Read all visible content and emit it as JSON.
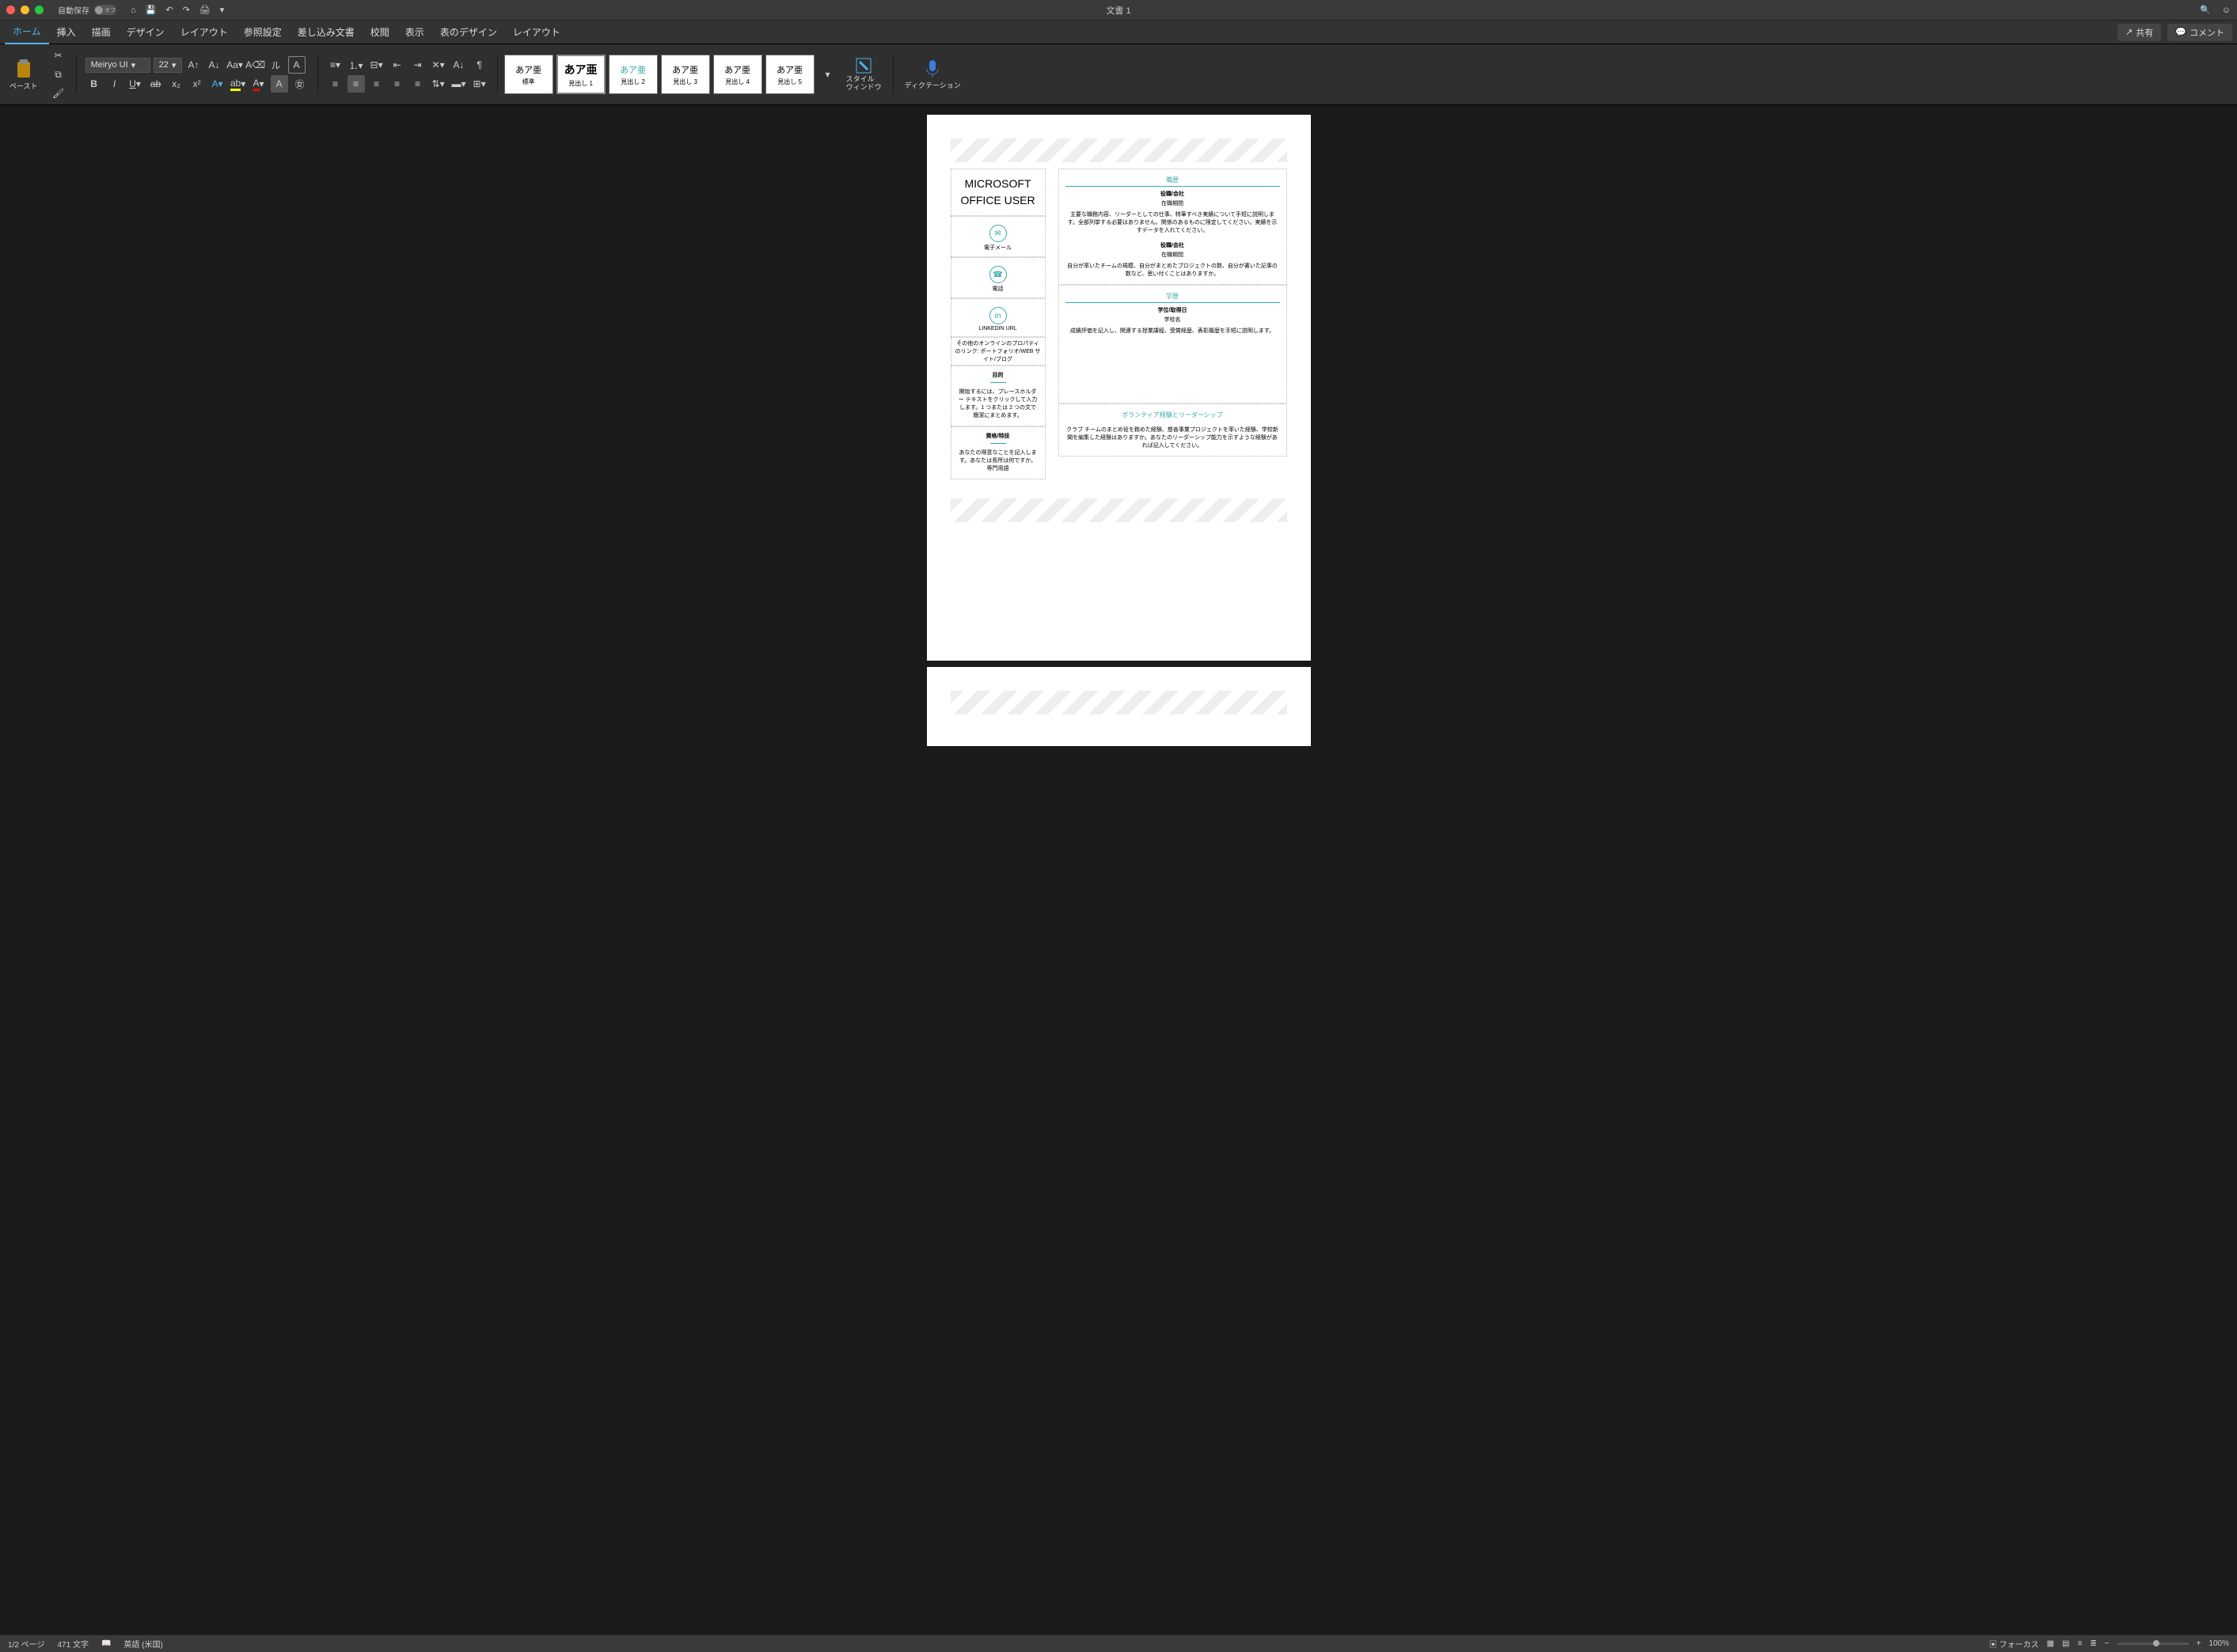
{
  "titlebar": {
    "autosave_label": "自動保存",
    "autosave_state": "オフ",
    "doc_title": "文書 1"
  },
  "menubar": {
    "tabs": [
      "ホーム",
      "挿入",
      "描画",
      "デザイン",
      "レイアウト",
      "参照設定",
      "差し込み文書",
      "校閲",
      "表示",
      "表のデザイン",
      "レイアウト"
    ],
    "share": "共有",
    "comment": "コメント"
  },
  "ribbon": {
    "paste": "ペースト",
    "font_name": "Meiryo UI",
    "font_size": "22",
    "styles": [
      {
        "preview": "あア亜",
        "label": "標準"
      },
      {
        "preview": "あア亜",
        "label": "見出し 1"
      },
      {
        "preview": "あア亜",
        "label": "見出し 2"
      },
      {
        "preview": "あア亜",
        "label": "見出し 3"
      },
      {
        "preview": "あア亜",
        "label": "見出し 4"
      },
      {
        "preview": "あア亜",
        "label": "見出し 5"
      }
    ],
    "style_pane": "スタイル\nウィンドウ",
    "dictation": "ディクテーション"
  },
  "document": {
    "name": "MICROSOFT OFFICE USER",
    "left": {
      "email": "電子メール",
      "phone": "電話",
      "linkedin": "LINKEDIN URL",
      "portfolio": "その他のオンラインのプロパティのリンク: ポートフォリオ/WEB サイト/ブログ",
      "obj_h": "目的",
      "obj_b": "開始するには、プレースホルダー テキストをクリックして入力します。1 つまたは 2 つの文で簡潔にまとめます。",
      "skill_h": "資格/特技",
      "skill_b": "あなたの得意なことを記入します。あなたは長所は何ですか。専門用語"
    },
    "right": {
      "career_h": "職歴",
      "job_t": "役職/会社",
      "job_p": "在職期間",
      "job1_b": "主要な職務内容、リーダーとしての仕事、特筆すべき実績について手短に説明します。全部列挙する必要はありません。関係のあるものに限定してください。実績を示すデータを入れてください。",
      "job2_b": "自分が率いたチームの規模、自分がまとめたプロジェクトの数、自分が書いた記事の数など、思い付くことはありますか。",
      "edu_h": "学歴",
      "deg": "学位/取得日",
      "school": "学校名",
      "edu_b": "成績評価を記入し、関連する授業課程、受賞経歴、表彰履歴を手短に説明します。",
      "vol_h": "ボランティア経験とリーダーシップ",
      "vol_b": "クラブ チームのまとめ役を務めた経験、慈善事業プロジェクトを率いた経験、学校新聞を編集した経験はありますか。あなたのリーダーシップ能力を示すような経験があれば記入してください。"
    }
  },
  "statusbar": {
    "page": "1/2 ページ",
    "words": "471 文字",
    "lang": "英語 (米国)",
    "focus": "フォーカス",
    "zoom": "100%"
  }
}
